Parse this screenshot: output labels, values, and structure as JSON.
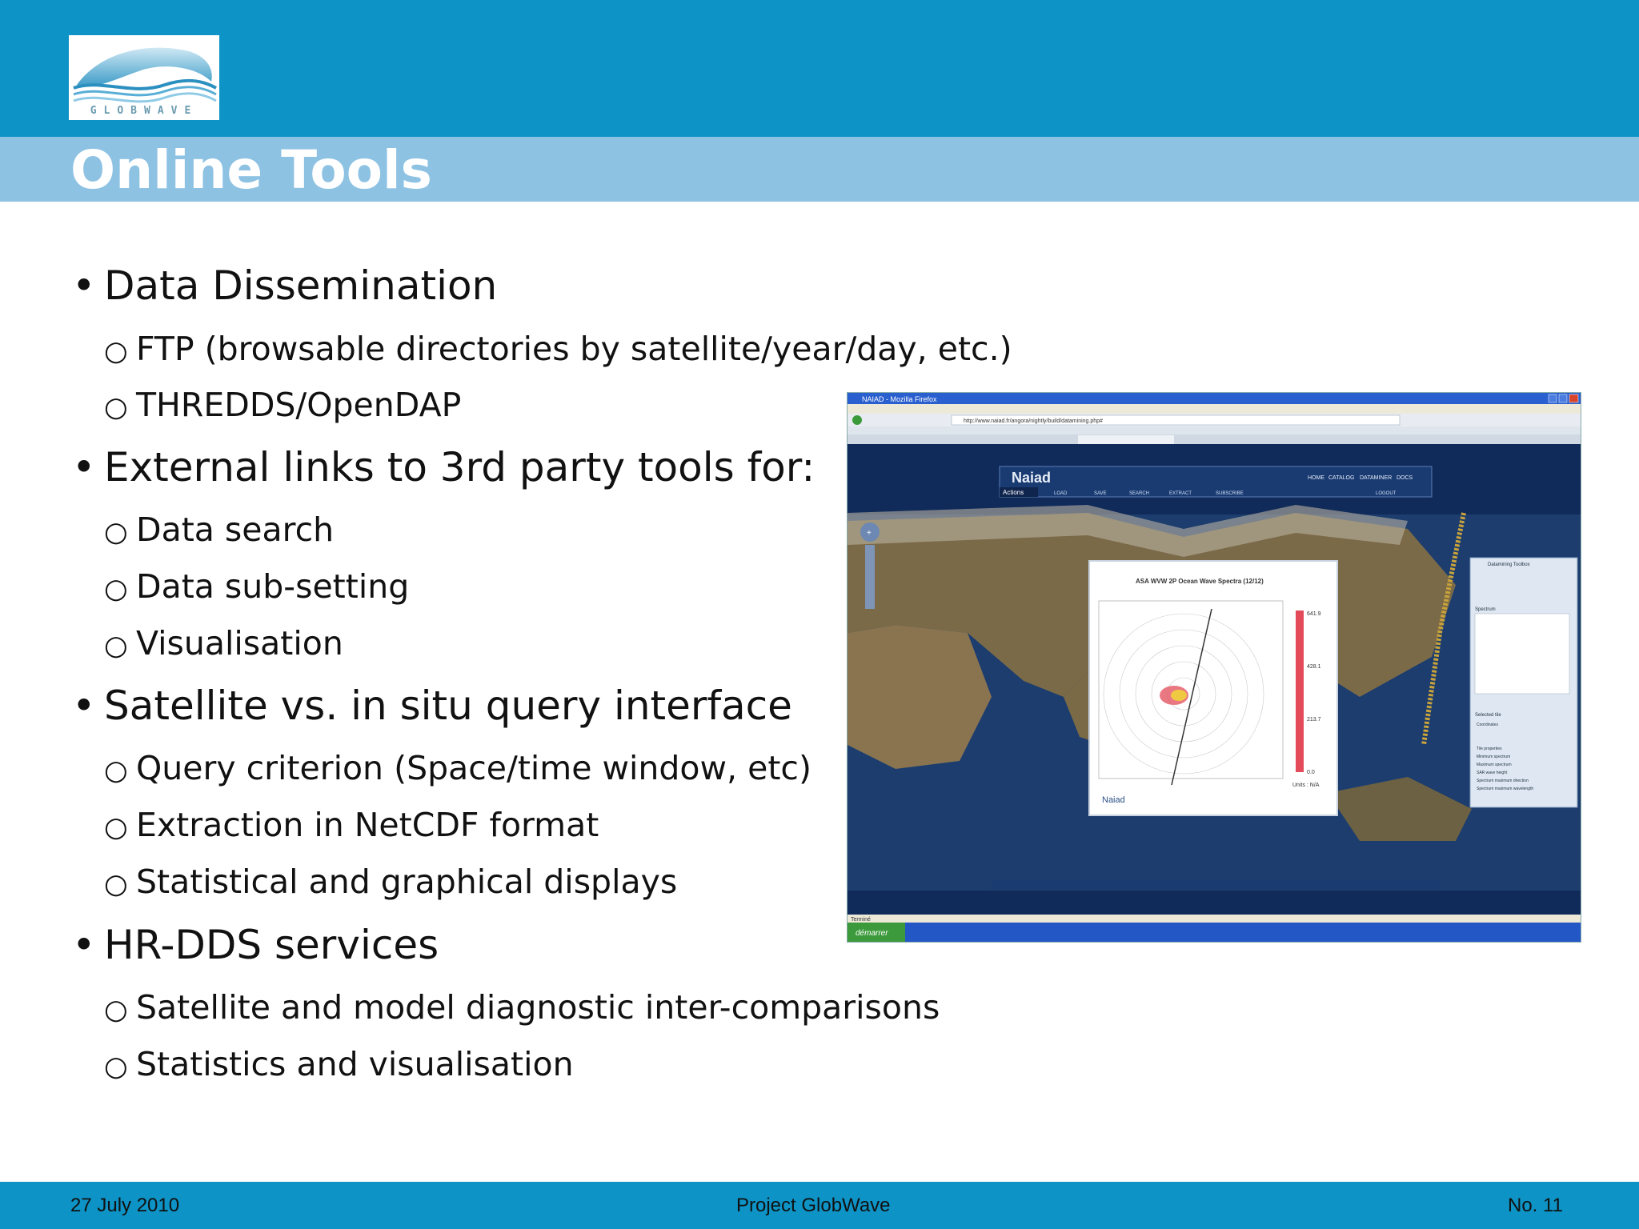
{
  "logo": {
    "text": "GLOBWAVE"
  },
  "title": "Online Tools",
  "bullets": [
    {
      "text": "Data Dissemination",
      "children": [
        "FTP (browsable directories by satellite/year/day, etc.)",
        "THREDDS/OpenDAP"
      ]
    },
    {
      "text": "External links to 3rd party tools for:",
      "children": [
        "Data search",
        "Data sub-setting",
        "Visualisation"
      ]
    },
    {
      "text": "Satellite vs. in situ query interface",
      "children": [
        "Query criterion (Space/time window, etc)",
        "Extraction in NetCDF format",
        "Statistical and graphical displays"
      ]
    },
    {
      "text": "HR-DDS services",
      "children": [
        "Satellite and model diagnostic inter-comparisons",
        "Statistics and visualisation"
      ]
    }
  ],
  "screenshot": {
    "window_title": "NAIAD - Mozilla Firefox",
    "url": "http://www.naiad.fr/angora/nightly/build/datamining.php#",
    "app_name": "Naiad",
    "nav": [
      "HOME",
      "CATALOG",
      "DATAMINER",
      "DOCS"
    ],
    "actions_label": "Actions",
    "toolbar": [
      "LOAD",
      "SAVE",
      "SEARCH",
      "EXTRACT",
      "SUBSCRIBE"
    ],
    "logout": "LOGOUT",
    "popup_title": "ASA WVW 2P Ocean Wave Spectra (12/12)",
    "colorbar_ticks": [
      "641.9",
      "428.1",
      "213.7",
      "0.0"
    ],
    "units_label": "Units : N/A",
    "popup_logo": "Naiad",
    "panel": {
      "header": "Datamining Toolbox",
      "spectrum_label": "Spectrum",
      "selected_tile": "Selected tile",
      "coordinates": "Coordinates",
      "tile_properties": "Tile properties",
      "rows": [
        "Minimum spectrum",
        "Maximum spectrum",
        "SAR wave height",
        "Spectrum maximum direction",
        "Spectrum maximum wavelength"
      ]
    },
    "start_button": "démarrer",
    "status": "Terminé",
    "colors": {
      "sky": "#102a5a",
      "ocean": "#1a3a6a",
      "land": "#7a6a48",
      "popup_bg": "#ffffff"
    }
  },
  "footer": {
    "date": "27 July 2010",
    "project": "Project GlobWave",
    "page": "No. 11"
  },
  "colors": {
    "band": "#0d93c5",
    "title_band": "#8ec2e3"
  }
}
